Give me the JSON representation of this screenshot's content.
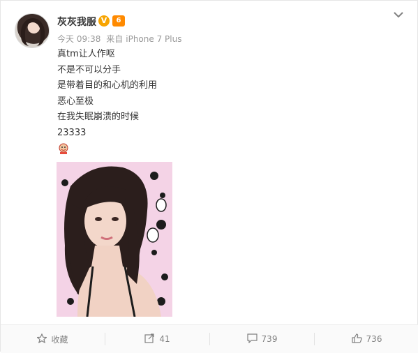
{
  "post": {
    "author": "灰灰我服",
    "verified_badge": "V",
    "vip_badge": "6",
    "meta": {
      "time": "今天 09:38",
      "source_prefix": "来自",
      "source": "iPhone 7 Plus"
    },
    "text_lines": [
      "真tm让人作呕",
      "不是不可以分手",
      "是带着目的和心机的利用",
      "恶心至极",
      "在我失眠崩溃的时候",
      "23333"
    ],
    "emoji": "reaction-emoji-icon",
    "colors": {
      "text": "#333333",
      "meta": "#999999",
      "verified": "#f7a400",
      "vip": "#ff8a00",
      "photo_background": "#f4d3e6"
    }
  },
  "toolbar": {
    "favorite_label": "收藏",
    "repost_count": "41",
    "comment_count": "739",
    "like_count": "736"
  }
}
